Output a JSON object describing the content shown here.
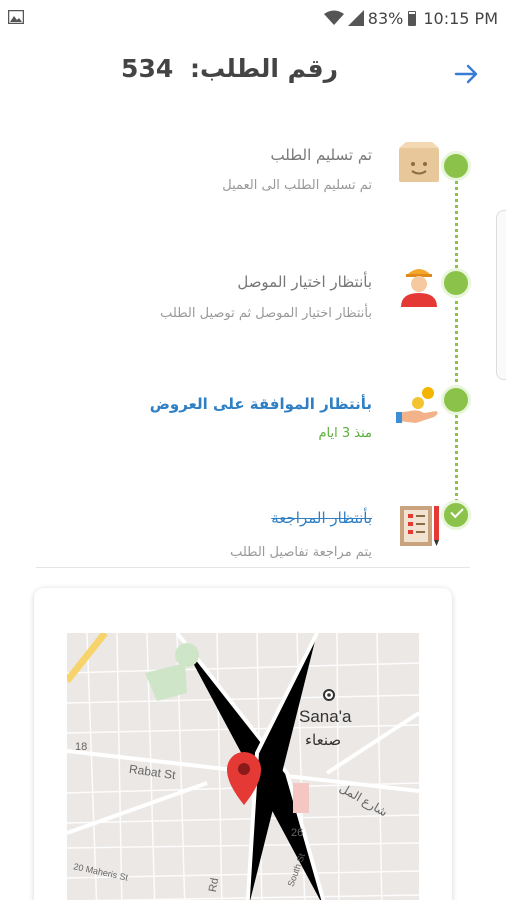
{
  "status_bar": {
    "battery": "83%",
    "time": "10:15 PM"
  },
  "header": {
    "title_label": "رقم الطلب:",
    "order_number": "534"
  },
  "timeline": {
    "steps": [
      {
        "title": "تم تسليم الطلب",
        "subtitle": "تم تسليم الطلب الى العميل",
        "icon": "package-box-icon",
        "state": "pending"
      },
      {
        "title": "بأنتظار اختيار الموصل",
        "subtitle": "بأنتظار اختيار الموصل ثم توصيل الطلب",
        "icon": "delivery-person-icon",
        "state": "pending"
      },
      {
        "title": "بأنتظار الموافقة على العروض",
        "subtitle": "منذ 3 ايام",
        "icon": "hand-coins-icon",
        "state": "active"
      },
      {
        "title": "بأنتظار المراجعة",
        "subtitle": "يتم مراجعة تفاصيل الطلب",
        "icon": "checklist-icon",
        "state": "done"
      }
    ]
  },
  "map": {
    "city_en": "Sana'a",
    "city_ar": "صنعاء",
    "street_rabat": "Rabat St",
    "street_ar": "شارع المل",
    "street_22nd": "20 Maheris St",
    "road_rd": "Rd",
    "south_st": "South St",
    "num_18": "18",
    "num_26": "26"
  },
  "colors": {
    "accent_green": "#8bc34a",
    "accent_blue": "#2e7fc4",
    "pin_red": "#e53935"
  }
}
